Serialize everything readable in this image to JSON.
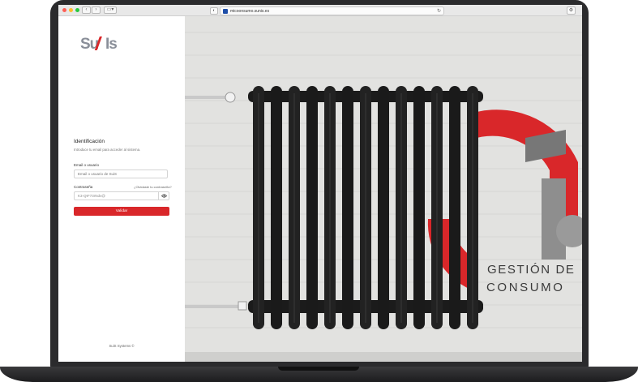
{
  "browser": {
    "url": "micoonsumo.sunis.es",
    "reload_icon": "reload-icon",
    "nav_back_icon": "chevron-left-icon",
    "nav_forward_icon": "chevron-right-icon",
    "sidebar_icon": "sidebar-icon",
    "shield_icon": "shield-icon",
    "settings_icon": "gear-icon"
  },
  "brand": {
    "logo_text": "SuSis",
    "accent_color": "#d9272a"
  },
  "login": {
    "title": "Identificación",
    "subtitle": "Introduce tu email para acceder al sistema.",
    "email_label": "Email o usuario",
    "email_placeholder": "Email o usuario de SuiS",
    "password_label": "Contraseña",
    "forgot_link": "¿Olvidaste tu contraseña?",
    "password_value": "K3-Q9*73rNdv@",
    "eye_icon": "eye-icon",
    "submit_label": "Validar"
  },
  "footer": {
    "text": "SuiS Systems ©"
  },
  "hero": {
    "line1": "GESTIÓN DE",
    "line2": "CONSUMO"
  }
}
